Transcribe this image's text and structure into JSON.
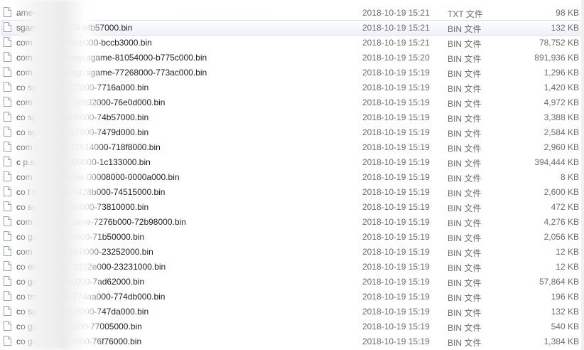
{
  "files": [
    {
      "name": "ame-maps.txt",
      "date": "2018-10-19 15:21",
      "type": "TXT 文件",
      "size": "98 KB"
    },
    {
      "name": "sgame-bfb36000-bfb57000.bin",
      "date": "2018-10-19 15:21",
      "type": "BIN 文件",
      "size": "132 KB"
    },
    {
      "name": "com sgame-b7fcb000-bccb3000.bin",
      "date": "2018-10-19 15:21",
      "type": "BIN 文件",
      "size": "78,752 KB"
    },
    {
      "name": "com.tencent.tmgp.sgame-81054000-b775c000.bin",
      "date": "2018-10-19 15:20",
      "type": "BIN 文件",
      "size": "891,936 KB"
    },
    {
      "name": "com.tencent.tmgp.sgame-77268000-773ac000.bin",
      "date": "2018-10-19 15:19",
      "type": "BIN 文件",
      "size": "1,296 KB"
    },
    {
      "name": "co sgame-77007000-7716a000.bin",
      "date": "2018-10-19 15:19",
      "type": "BIN 文件",
      "size": "1,420 KB"
    },
    {
      "name": "com gp.s ame-76932000-76e0d000.bin",
      "date": "2018-10-19 15:19",
      "type": "BIN 文件",
      "size": "4,972 KB"
    },
    {
      "name": "co sgame-74808000-74b57000.bin",
      "date": "2018-10-19 15:19",
      "type": "BIN 文件",
      "size": "3,388 KB"
    },
    {
      "name": "co sgame-74517000-7479d000.bin",
      "date": "2018-10-19 15:19",
      "type": "BIN 文件",
      "size": "2,584 KB"
    },
    {
      "name": "com p.sgame-71614000-718f8000.bin",
      "date": "2018-10-19 15:19",
      "type": "BIN 文件",
      "size": "2,960 KB"
    },
    {
      "name": "c p.sgame-04000000-1c133000.bin",
      "date": "2018-10-19 15:19",
      "type": "BIN 文件",
      "size": "394,444 KB"
    },
    {
      "name": "com. tmgp.sgame-00008000-0000a000.bin",
      "date": "2018-10-19 15:19",
      "type": "BIN 文件",
      "size": "8 KB"
    },
    {
      "name": "co t tm sgame-7428b000-74515000.bin",
      "date": "2018-10-19 15:19",
      "type": "BIN 文件",
      "size": "2,600 KB"
    },
    {
      "name": "co sgame-7379a000-73810000.bin",
      "date": "2018-10-19 15:19",
      "type": "BIN 文件",
      "size": "472 KB"
    },
    {
      "name": "com.tencent sgame-7276b000-72b98000.bin",
      "date": "2018-10-19 15:19",
      "type": "BIN 文件",
      "size": "4,276 KB"
    },
    {
      "name": "co game-7194e000-71b50000.bin",
      "date": "2018-10-19 15:19",
      "type": "BIN 文件",
      "size": "2,056 KB"
    },
    {
      "name": "com sgame-2324f000-23252000.bin",
      "date": "2018-10-19 15:19",
      "type": "BIN 文件",
      "size": "12 KB"
    },
    {
      "name": "co ent tmg me-2322e000-23231000.bin",
      "date": "2018-10-19 15:19",
      "type": "BIN 文件",
      "size": "12 KB"
    },
    {
      "name": "co game-774e0000-7ad62000.bin",
      "date": "2018-10-19 15:19",
      "type": "BIN 文件",
      "size": "57,864 KB"
    },
    {
      "name": "co tmg sgame-774aa000-774db000.bin",
      "date": "2018-10-19 15:19",
      "type": "BIN 文件",
      "size": "196 KB"
    },
    {
      "name": "co sgame-747b9000-747da000.bin",
      "date": "2018-10-19 15:19",
      "type": "BIN 文件",
      "size": "132 KB"
    },
    {
      "name": "co game-76f7e000-77005000.bin",
      "date": "2018-10-19 15:19",
      "type": "BIN 文件",
      "size": "540 KB"
    },
    {
      "name": "co game-76e1c000-76f76000.bin",
      "date": "2018-10-19 15:19",
      "type": "BIN 文件",
      "size": "1,384 KB"
    }
  ]
}
